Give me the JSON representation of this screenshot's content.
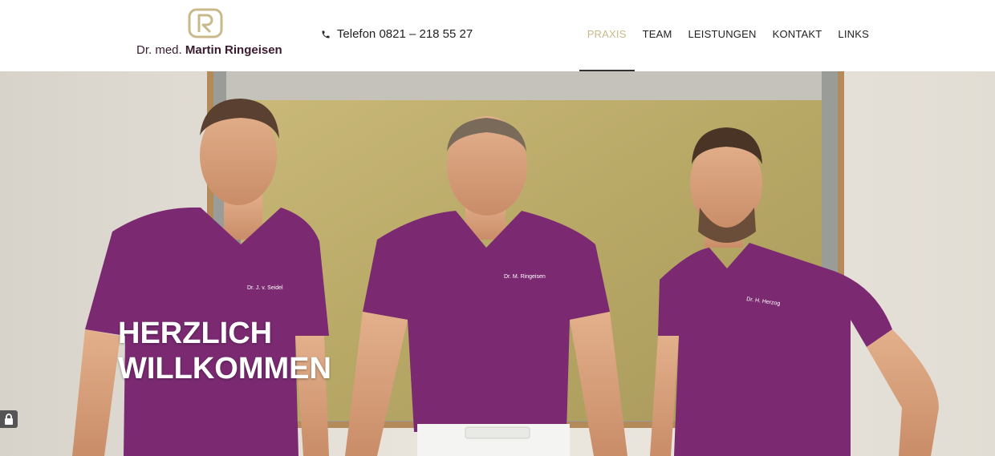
{
  "header": {
    "logo": {
      "prefix": "Dr. med.",
      "name": "Martin Ringeisen",
      "monogram": "R"
    },
    "phone": {
      "label": "Telefon 0821 – 218 55 27",
      "icon": "phone-icon"
    },
    "nav": [
      {
        "label": "PRAXIS",
        "active": true
      },
      {
        "label": "TEAM"
      },
      {
        "label": "LEISTUNGEN"
      },
      {
        "label": "KONTAKT"
      },
      {
        "label": "LINKS"
      }
    ]
  },
  "hero": {
    "title_line1": "HERZLICH",
    "title_line2": "WILLKOMMEN",
    "shirt_labels": [
      "Dr. J. v. Seidel",
      "Dr. M. Ringeisen",
      "Dr. H. Herzog"
    ]
  },
  "colors": {
    "accent": "#c9b98a",
    "brand": "#3a1a2e",
    "shirt": "#7b2a72"
  },
  "widgets": {
    "lock_icon": "lock-icon"
  }
}
